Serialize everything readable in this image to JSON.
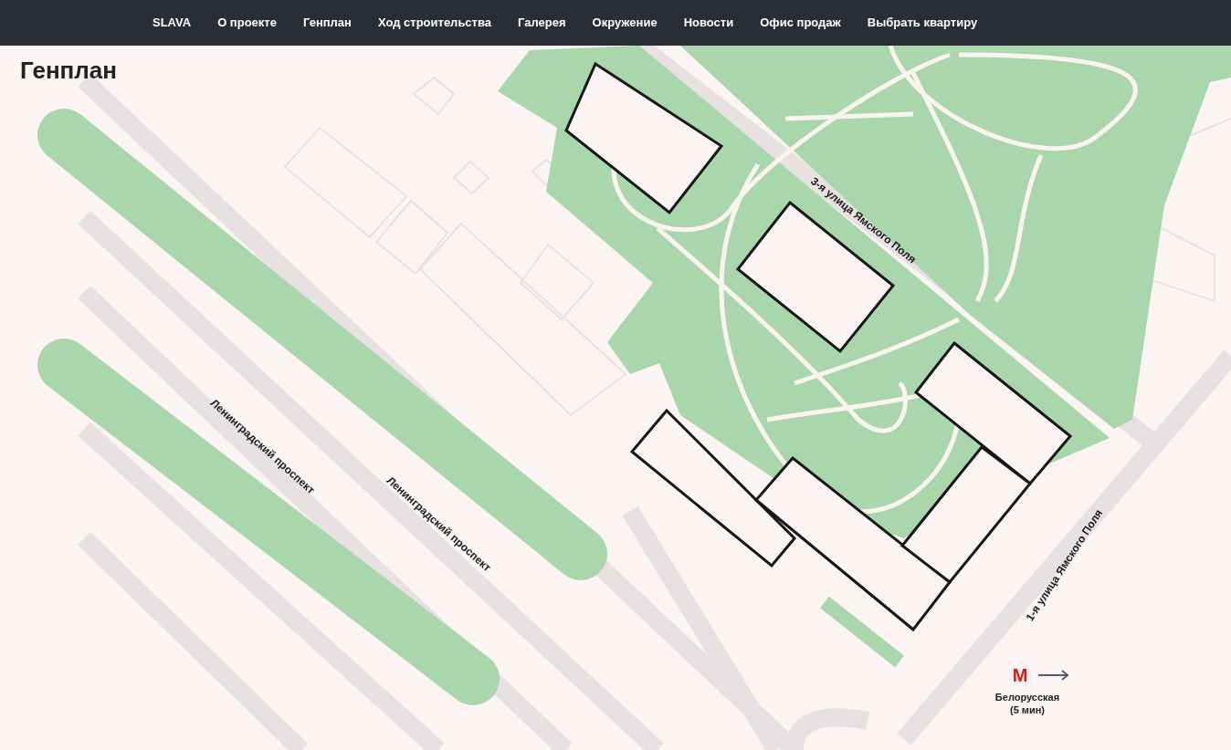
{
  "nav": {
    "items": [
      "SLAVA",
      "О проекте",
      "Генплан",
      "Ход строительства",
      "Галерея",
      "Окружение",
      "Новости",
      "Офис продаж",
      "Выбрать квартиру"
    ]
  },
  "page_title": "Генплан",
  "map": {
    "street_labels": [
      {
        "text": "3-я улица Ямского Поля"
      },
      {
        "text": "Ленинградский проспект"
      },
      {
        "text": "Ленинградский проспект"
      },
      {
        "text": "1-я улица Ямского Поля"
      }
    ],
    "metro": {
      "mark": "M",
      "station": "Белорусская",
      "walk_time": "(5 мин)"
    }
  }
}
